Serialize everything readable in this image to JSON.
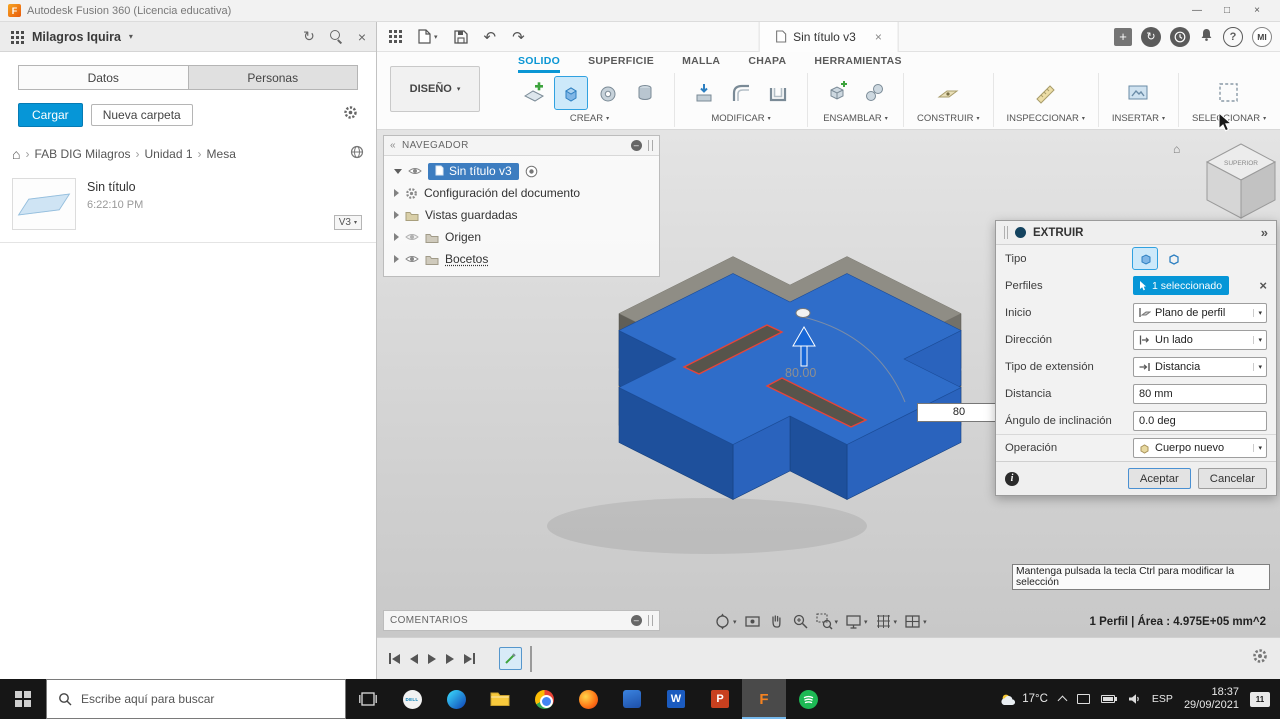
{
  "window": {
    "title": "Autodesk Fusion 360 (Licencia educativa)"
  },
  "glyphs": {
    "caret": "▾",
    "close": "×",
    "chevron": "›",
    "collapse": "«",
    "dock": "»",
    "refresh": "↻",
    "undo": "↶",
    "redo": "↷",
    "home": "⌂",
    "minus": "–",
    "minimize": "—",
    "maximize": "□",
    "question": "?",
    "plus": "+",
    "up_chevron": "^"
  },
  "data_panel": {
    "account": "Milagros Iquira",
    "tabs": [
      {
        "label": "Datos"
      },
      {
        "label": "Personas"
      }
    ],
    "upload": "Cargar",
    "new_folder": "Nueva carpeta",
    "breadcrumb": {
      "items": [
        "FAB DIG Milagros",
        "Unidad 1",
        "Mesa"
      ]
    },
    "file": {
      "name": "Sin título",
      "time": "6:22:10 PM",
      "version": "V3"
    }
  },
  "appbar": {
    "tab": "Sin título v3",
    "avatar": "MI"
  },
  "ribbon": {
    "workspace": "DISEÑO",
    "tabs": [
      "SOLIDO",
      "SUPERFICIE",
      "MALLA",
      "CHAPA",
      "HERRAMIENTAS"
    ],
    "groups": [
      {
        "label": "CREAR"
      },
      {
        "label": "MODIFICAR"
      },
      {
        "label": "ENSAMBLAR"
      },
      {
        "label": "CONSTRUIR"
      },
      {
        "label": "INSPECCIONAR"
      },
      {
        "label": "INSERTAR"
      },
      {
        "label": "SELECCIONAR"
      }
    ]
  },
  "navigator": {
    "title": "NAVEGADOR",
    "rows": [
      {
        "label": "Sin título v3"
      },
      {
        "label": "Configuración del documento"
      },
      {
        "label": "Vistas guardadas"
      },
      {
        "label": "Origen"
      },
      {
        "label": "Bocetos"
      }
    ]
  },
  "comments": {
    "title": "COMENTARIOS"
  },
  "viewcube": {
    "top": "SUPERIOR"
  },
  "canvas": {
    "dimension": "80.00",
    "dim_input": "80"
  },
  "dialog": {
    "title": "EXTRUIR",
    "rows": {
      "tipo": "Tipo",
      "perfiles": "Perfiles",
      "perfiles_value": "1 seleccionado",
      "inicio": "Inicio",
      "inicio_value": "Plano de perfil",
      "direccion": "Dirección",
      "direccion_value": "Un lado",
      "extension": "Tipo de extensión",
      "extension_value": "Distancia",
      "distancia": "Distancia",
      "distancia_value": "80 mm",
      "angulo": "Ángulo de inclinación",
      "angulo_value": "0.0 deg",
      "operacion": "Operación",
      "operacion_value": "Cuerpo nuevo"
    },
    "accept": "Aceptar",
    "cancel": "Cancelar"
  },
  "tooltip": "Mantenga pulsada la tecla Ctrl para modificar la selección",
  "statusbar": "1 Perfil | Área : 4.975E+05 mm^2",
  "taskbar": {
    "search_placeholder": "Escribe aquí para buscar",
    "weather": "17°C",
    "lang": "ESP",
    "time": "18:37",
    "date": "29/09/2021",
    "badge": "11"
  }
}
